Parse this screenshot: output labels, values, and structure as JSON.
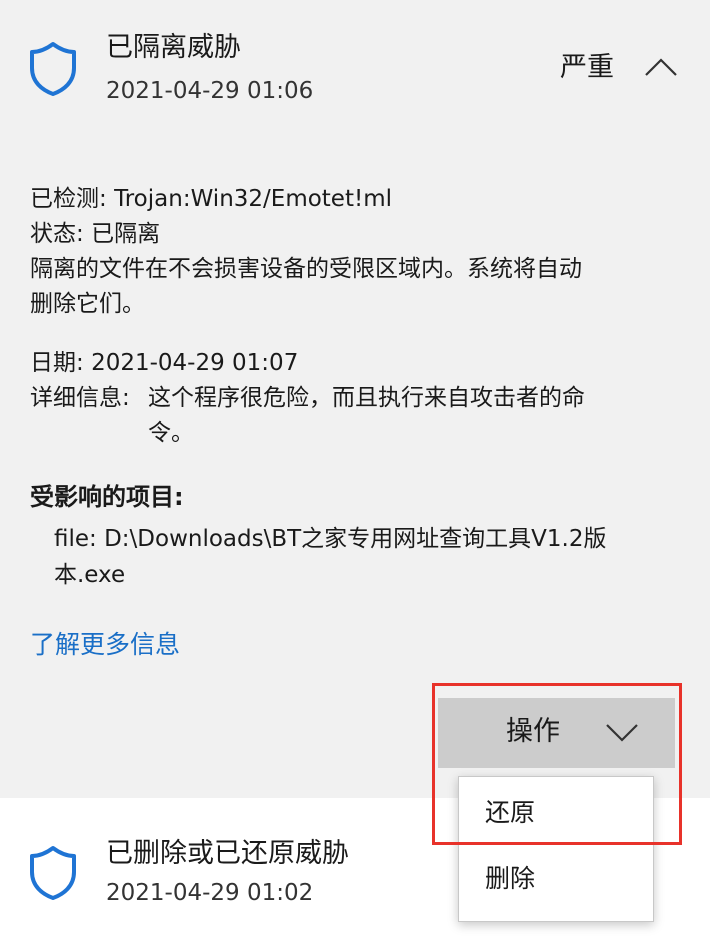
{
  "threat1": {
    "title": "已隔离威胁",
    "date": "2021-04-29 01:06",
    "severity": "严重",
    "detected_label": "已检测:",
    "detected_value": "Trojan:Win32/Emotet!ml",
    "status_label": "状态:",
    "status_value": "已隔离",
    "desc_line1": "隔离的文件在不会损害设备的受限区域内。系统将自动",
    "desc_line2": "删除它们。",
    "date_label": "日期:",
    "date_value": "2021-04-29 01:07",
    "details_label": "详细信息:",
    "details_value_line1": "这个程序很危险，而且执行来自攻击者的命",
    "details_value_line2": "令。",
    "affected_title": "受影响的项目:",
    "file_line1": "file: D:\\Downloads\\BT之家专用网址查询工具V1.2版",
    "file_line2": "本.exe",
    "learn_more": "了解更多信息"
  },
  "actions": {
    "label": "操作",
    "menu": [
      "还原",
      "删除"
    ]
  },
  "threat2": {
    "title": "已删除或已还原威胁",
    "date": "2021-04-29 01:02"
  },
  "colors": {
    "accent": "#1a6fc7",
    "highlight": "#e8322a",
    "shield": "#1f74d4"
  },
  "icons": {
    "shield": "shield-icon",
    "collapse": "chevron-up-icon",
    "dropdown": "chevron-down-icon"
  }
}
